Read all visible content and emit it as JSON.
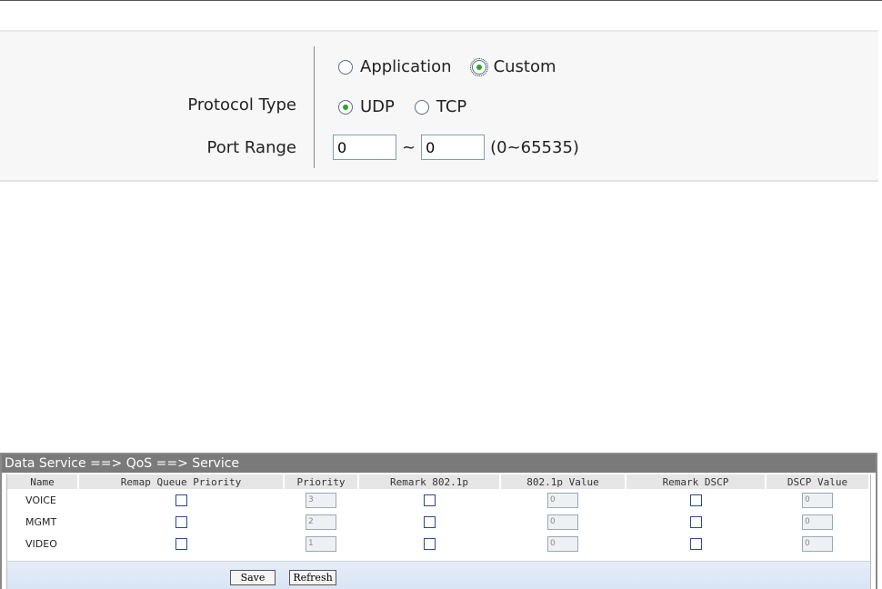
{
  "protocol_panel": {
    "mode_options": [
      {
        "label": "Application",
        "selected": false
      },
      {
        "label": "Custom",
        "selected": true
      }
    ],
    "protocol_type_label": "Protocol Type",
    "protocol_options": [
      {
        "label": "UDP",
        "selected": true
      },
      {
        "label": "TCP",
        "selected": false
      }
    ],
    "port_range_label": "Port Range",
    "port_from": "0",
    "port_separator": "~",
    "port_to": "0",
    "port_hint": "(0~65535)"
  },
  "qos_panel": {
    "title": "Data Service ==> QoS ==> Service",
    "columns": [
      "Name",
      "Remap Queue Priority",
      "Priority",
      "Remark 802.1p",
      "802.1p Value",
      "Remark DSCP",
      "DSCP Value"
    ],
    "rows": [
      {
        "name": "VOICE",
        "priority": "3",
        "p8021_value": "0",
        "dscp_value": "0"
      },
      {
        "name": "MGMT",
        "priority": "2",
        "p8021_value": "0",
        "dscp_value": "0"
      },
      {
        "name": "VIDEO",
        "priority": "1",
        "p8021_value": "0",
        "dscp_value": "0"
      }
    ],
    "save_label": "Save",
    "refresh_label": "Refresh"
  }
}
